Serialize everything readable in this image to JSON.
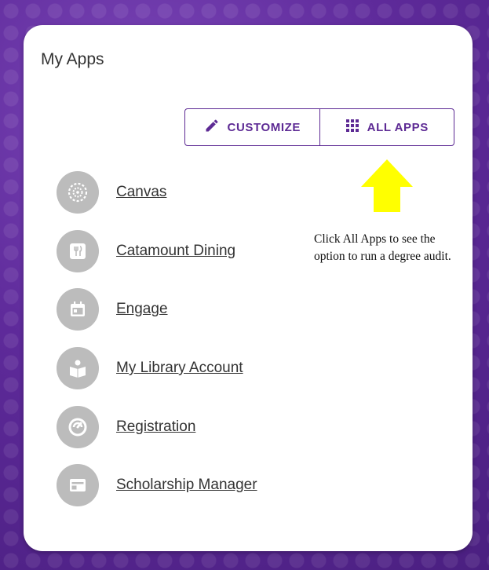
{
  "card": {
    "title": "My Apps"
  },
  "toolbar": {
    "customize_label": "CUSTOMIZE",
    "all_apps_label": "ALL APPS"
  },
  "apps": [
    {
      "label": "Canvas",
      "icon": "canvas-icon"
    },
    {
      "label": "Catamount Dining",
      "icon": "dining-icon"
    },
    {
      "label": "Engage",
      "icon": "calendar-icon"
    },
    {
      "label": "My Library Account",
      "icon": "library-icon"
    },
    {
      "label": "Registration",
      "icon": "registration-icon"
    },
    {
      "label": "Scholarship Manager",
      "icon": "scholarship-icon"
    }
  ],
  "annotation": {
    "text": "Click All Apps to see the option to run a degree audit."
  },
  "colors": {
    "accent": "#5d2a94",
    "arrow": "#ffff00",
    "icon_bg": "#bcbcbc"
  }
}
